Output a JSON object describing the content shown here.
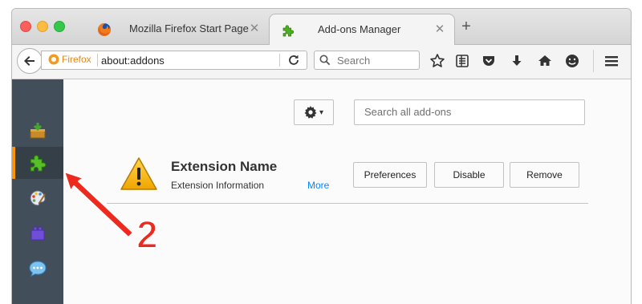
{
  "window": {
    "tabs": [
      {
        "title": "Mozilla Firefox Start Page",
        "icon": "firefox-icon",
        "active": false
      },
      {
        "title": "Add-ons Manager",
        "icon": "puzzle-icon",
        "active": true
      }
    ],
    "tab_close_glyph": "✕",
    "new_tab_glyph": "+"
  },
  "navbar": {
    "identity_label": "Firefox",
    "url": "about:addons",
    "search_placeholder": "Search",
    "icons": [
      "back-arrow-icon",
      "reload-icon",
      "search-icon",
      "bookmark-star-icon",
      "reading-list-icon",
      "pocket-icon",
      "download-icon",
      "home-icon",
      "hello-icon",
      "hamburger-menu-icon"
    ]
  },
  "sidebar": {
    "categories": [
      {
        "id": "get-addons",
        "icon": "get-addons-icon",
        "selected": false
      },
      {
        "id": "extensions",
        "icon": "puzzle-icon",
        "selected": true
      },
      {
        "id": "appearance",
        "icon": "palette-icon",
        "selected": false
      },
      {
        "id": "plugins",
        "icon": "plugin-block-icon",
        "selected": false
      },
      {
        "id": "services",
        "icon": "speech-bubble-icon",
        "selected": false
      }
    ]
  },
  "content": {
    "search_placeholder": "Search all add-ons",
    "gear_caret": "▾",
    "extension": {
      "name": "Extension Name",
      "info": "Extension Information",
      "more_link": "More",
      "buttons": {
        "preferences": "Preferences",
        "disable": "Disable",
        "remove": "Remove"
      }
    }
  },
  "annotation": {
    "number": "2",
    "color": "#ee2a1f"
  },
  "colors": {
    "accent_orange": "#ff9500",
    "sidebar_bg": "#424f5a",
    "link_blue": "#0a84ff"
  }
}
